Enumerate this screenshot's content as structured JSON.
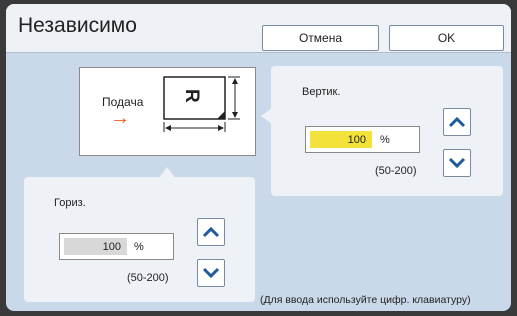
{
  "header": {
    "title": "Независимо",
    "cancel_label": "Отмена",
    "ok_label": "OK"
  },
  "diagram": {
    "feed_label": "Подача",
    "feed_arrow": "→",
    "paper_letter": "R"
  },
  "vertical": {
    "label": "Вертик.",
    "value": "100",
    "unit": "%",
    "range": "(50-200)"
  },
  "horizontal": {
    "label": "Гориз.",
    "value": "100",
    "unit": "%",
    "range": "(50-200)"
  },
  "hint": "(Для ввода используйте цифр. клавиатуру)",
  "colors": {
    "active_field": "#f2e23a",
    "inactive_field": "#d8d8d8",
    "spinner_icon": "#1f5a9c",
    "feed_arrow": "#f05a1e"
  },
  "icons": [
    "chevron-up-icon",
    "chevron-down-icon",
    "arrow-right-icon"
  ]
}
